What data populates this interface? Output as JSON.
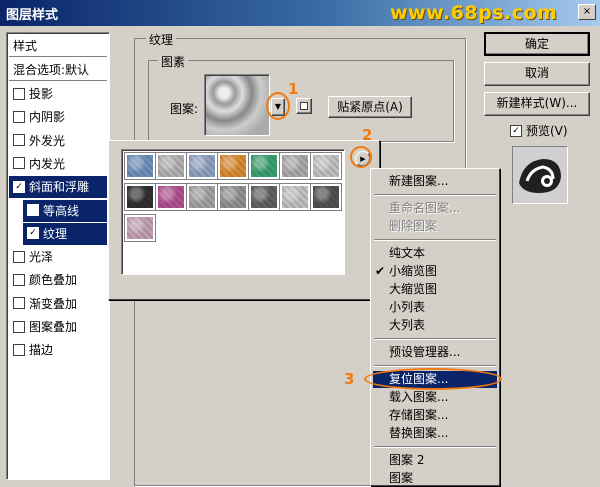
{
  "window": {
    "title": "图层样式",
    "watermark": "www.68ps.com",
    "close": "×"
  },
  "style_list": {
    "header": "样式",
    "blend_options": "混合选项:默认",
    "items": [
      {
        "label": "投影",
        "checked": false
      },
      {
        "label": "内阴影",
        "checked": false
      },
      {
        "label": "外发光",
        "checked": false
      },
      {
        "label": "内发光",
        "checked": false
      },
      {
        "label": "斜面和浮雕",
        "checked": true
      },
      {
        "label": "等高线",
        "checked": false
      },
      {
        "label": "纹理",
        "checked": true
      },
      {
        "label": "光泽",
        "checked": false
      },
      {
        "label": "颜色叠加",
        "checked": false
      },
      {
        "label": "渐变叠加",
        "checked": false
      },
      {
        "label": "图案叠加",
        "checked": false
      },
      {
        "label": "描边",
        "checked": false
      }
    ],
    "check_mark": "✓"
  },
  "texture_panel": {
    "group_title": "纹理",
    "sub_group_title": "图素",
    "pattern_label": "图案:",
    "snap_button": "贴紧原点(A)",
    "dropdown_arrow": "▼"
  },
  "buttons": {
    "ok": "确定",
    "cancel": "取消",
    "new_style": "新建样式(W)...",
    "preview": "预览(V)",
    "preview_checked": true
  },
  "pattern_picker": {
    "menu_arrow": "▶",
    "swatch_colors": [
      "#6e8fb8",
      "#b0b0b0",
      "#8ea0c0",
      "#d88a30",
      "#3aa070",
      "#a8a8a8",
      "#c0c0c0",
      "#303030",
      "#b05090",
      "#a0a0a0",
      "#909090",
      "#606060",
      "#c0c0c0",
      "#505050",
      "#c0a0b0"
    ]
  },
  "menu": {
    "groups": [
      [
        {
          "label": "新建图案...",
          "enabled": true
        }
      ],
      [
        {
          "label": "重命名图案...",
          "enabled": false
        },
        {
          "label": "删除图案",
          "enabled": false
        }
      ],
      [
        {
          "label": "纯文本",
          "enabled": true
        },
        {
          "label": "小缩览图",
          "enabled": true,
          "checked": true
        },
        {
          "label": "大缩览图",
          "enabled": true
        },
        {
          "label": "小列表",
          "enabled": true
        },
        {
          "label": "大列表",
          "enabled": true
        }
      ],
      [
        {
          "label": "预设管理器...",
          "enabled": true
        }
      ],
      [
        {
          "label": "复位图案...",
          "enabled": true,
          "highlighted": true
        },
        {
          "label": "载入图案...",
          "enabled": true
        },
        {
          "label": "存储图案...",
          "enabled": true
        },
        {
          "label": "替换图案...",
          "enabled": true
        }
      ],
      [
        {
          "label": "图案 2",
          "enabled": true
        },
        {
          "label": "图案",
          "enabled": true
        }
      ]
    ],
    "check_mark": "✔"
  },
  "annotations": {
    "one": "1",
    "two": "2",
    "three": "3",
    "accent": "#f07a10"
  }
}
